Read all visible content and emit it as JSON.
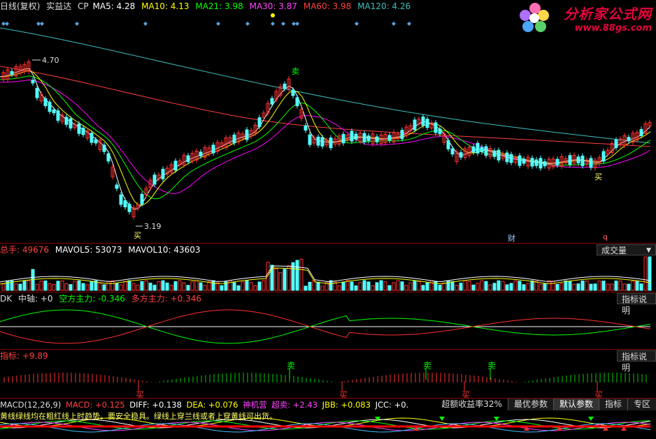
{
  "main": {
    "title": "日线(复权)",
    "name": "实益达",
    "cp": "CP",
    "ma5": "MA5: 4.28",
    "ma10": "MA10: 4.13",
    "ma21": "MA21: 3.98",
    "ma30": "MA30: 3.87",
    "ma60": "MA60: 3.98",
    "ma120": "MA120: 4.26",
    "high_price": "4.70",
    "low_price": "3.19",
    "mark_cai": "财",
    "mark_q": "q",
    "buy": "买",
    "sell": "卖"
  },
  "watermark": {
    "title": "分析家公式网",
    "url": "www.88gs.com"
  },
  "volume": {
    "zongshou": "总手: 49676",
    "mavol5": "MAVOL5: 53073",
    "mavol10": "MAVOL10: 43603",
    "button": "成交量"
  },
  "dk": {
    "label": "DK",
    "zhongzhou": "中轴: +0",
    "kong": "空方主力: -0.346",
    "duo": "多方主力: +0.346",
    "button": "指标说明"
  },
  "zhibiao": {
    "label": "指标: +9.89",
    "button": "指标说明"
  },
  "macd": {
    "label": "MACD(12,26,9)",
    "macd": "MACD: +0.125",
    "diff": "DIFF: +0.138",
    "dea": "DEA: +0.076",
    "shenjiying": "神机营",
    "chaomai": "超卖: +2.43",
    "jbb": "JBB: +0.083",
    "jcc": "JCC: +0.",
    "note": "黄线绿线均在粗红线上时趋势。要安全稳具。绿线上穿兰线或者上穿黄线可出货。"
  },
  "tabs": {
    "yield": "超额收益率32%",
    "best": "最优参数",
    "default": "默认参数",
    "zhibiao": "指标",
    "zone": "专区"
  },
  "colors": {
    "up": "#ff3232",
    "down": "#54ffff",
    "ma5": "#ffffff",
    "ma10": "#ffff00",
    "ma21": "#00ff00",
    "ma30": "#ff00ff",
    "ma60": "#ff4040",
    "ma120": "#40c0c0"
  }
}
